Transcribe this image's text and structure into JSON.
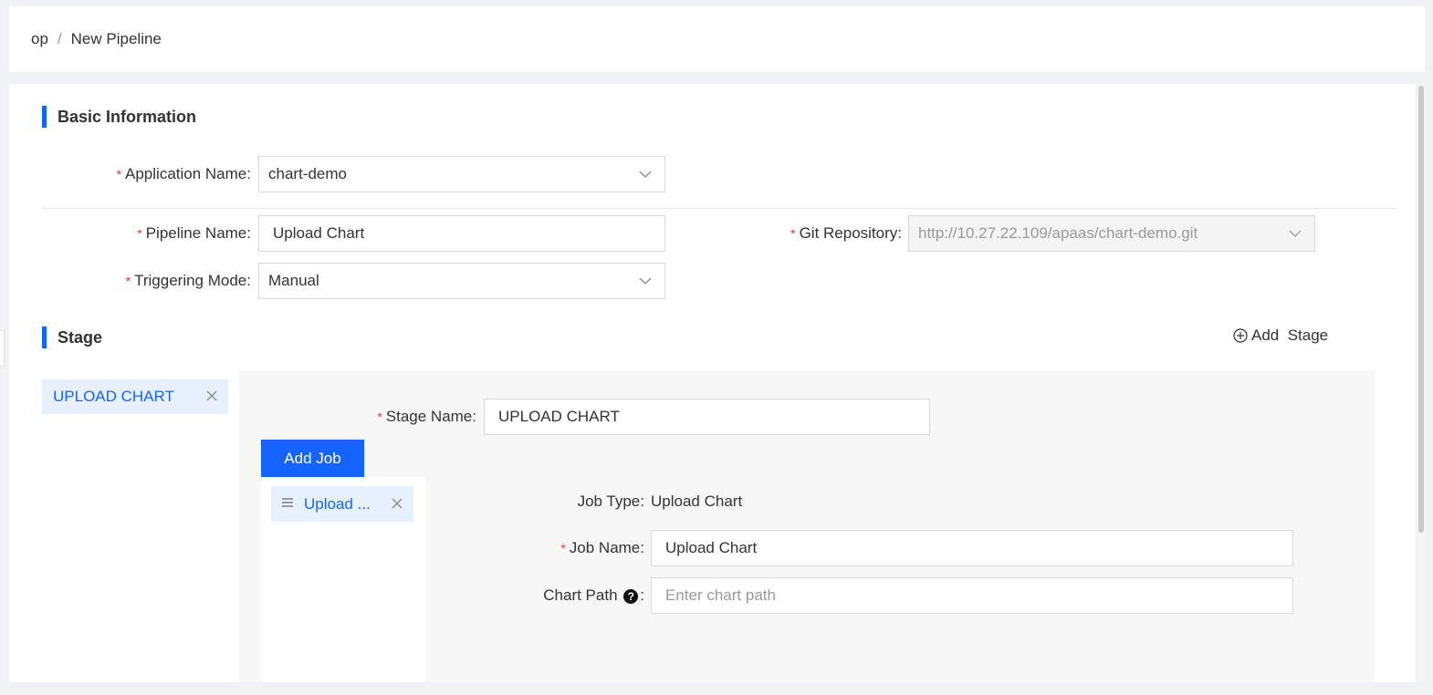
{
  "breadcrumb": {
    "parent": "op",
    "separator": "/",
    "current": "New Pipeline"
  },
  "basic": {
    "title": "Basic Information",
    "application_label": "Application Name",
    "application_value": "chart-demo",
    "pipeline_label": "Pipeline Name",
    "pipeline_value": "Upload Chart",
    "git_label": "Git Repository",
    "git_value": "http://10.27.22.109/apaas/chart-demo.git",
    "trigger_label": "Triggering Mode",
    "trigger_value": "Manual",
    "colon": ":",
    "required_mark": "*"
  },
  "stage": {
    "title": "Stage",
    "add_label": "Add  Stage",
    "items": [
      {
        "label": "UPLOAD CHART"
      }
    ],
    "name_label": "Stage Name",
    "name_value": "UPLOAD CHART",
    "add_job_label": "Add Job"
  },
  "job": {
    "items": [
      {
        "label": "Upload ..."
      }
    ],
    "type_label": "Job Type",
    "type_value": "Upload Chart",
    "name_label": "Job Name",
    "name_value": "Upload Chart",
    "path_label": "Chart Path",
    "path_placeholder": "Enter chart path",
    "help_glyph": "?"
  },
  "colors": {
    "accent": "#1664ff",
    "required": "#e53935",
    "selected_bg": "#e6f0ff"
  }
}
